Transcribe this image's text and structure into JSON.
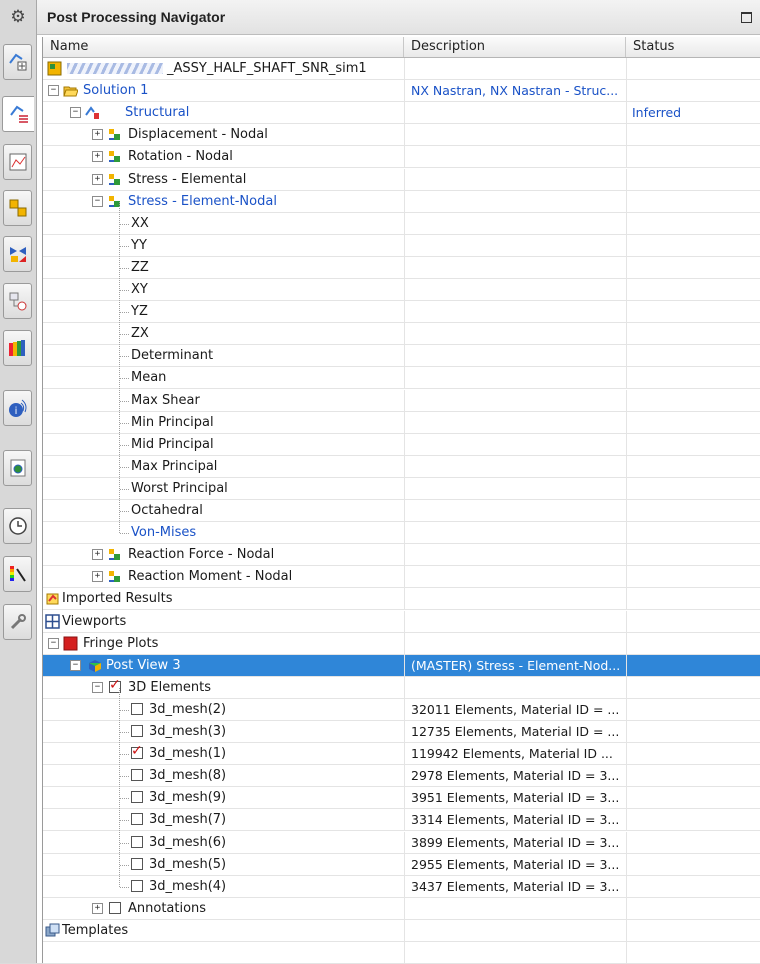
{
  "panel": {
    "title": "Post Processing Navigator"
  },
  "columns": {
    "name": "Name",
    "description": "Description",
    "status": "Status"
  },
  "rail": [
    {
      "icon": "gear-icon"
    },
    {
      "icon": "part-navigator-icon"
    },
    {
      "icon": "post-processing-navigator-icon"
    },
    {
      "icon": "graph-icon"
    },
    {
      "icon": "assembly-icon"
    },
    {
      "icon": "constraints-icon"
    },
    {
      "icon": "reuse-library-icon"
    },
    {
      "icon": "roles-icon"
    },
    {
      "icon": "info-icon"
    },
    {
      "icon": "web-browser-icon"
    },
    {
      "icon": "history-icon"
    },
    {
      "icon": "palette-icon"
    },
    {
      "icon": "tools-icon"
    }
  ],
  "tree": {
    "root": {
      "label": "_ASSY_HALF_SHAFT_SNR_sim1",
      "icon": "sim-file-icon"
    },
    "solution": {
      "label": "Solution 1",
      "description": "NX Nastran, NX Nastran - Struc...",
      "icon": "folder-open-icon"
    },
    "structural": {
      "label": "Structural",
      "status": "Inferred",
      "icon": "structural-icon"
    },
    "results": [
      {
        "label": "Displacement - Nodal",
        "expanded": false
      },
      {
        "label": "Rotation - Nodal",
        "expanded": false
      },
      {
        "label": "Stress - Elemental",
        "expanded": false
      },
      {
        "label": "Stress - Element-Nodal",
        "expanded": true
      }
    ],
    "stress_components": [
      "XX",
      "YY",
      "ZZ",
      "XY",
      "YZ",
      "ZX",
      "Determinant",
      "Mean",
      "Max Shear",
      "Min Principal",
      "Mid Principal",
      "Max Principal",
      "Worst Principal",
      "Octahedral",
      "Von-Mises"
    ],
    "active_component": "Von-Mises",
    "reactions": [
      {
        "label": "Reaction Force - Nodal"
      },
      {
        "label": "Reaction Moment - Nodal"
      }
    ],
    "imported_results": "Imported Results",
    "viewports": "Viewports",
    "fringe_plots": "Fringe Plots",
    "post_view": {
      "label": "Post View 3",
      "description": "(MASTER) Stress - Element-Nod..."
    },
    "elements_3d": "3D Elements",
    "meshes": [
      {
        "label": "3d_mesh(2)",
        "description": "32011 Elements, Material ID = ...",
        "checked": false
      },
      {
        "label": "3d_mesh(3)",
        "description": "12735 Elements, Material ID = ...",
        "checked": false
      },
      {
        "label": "3d_mesh(1)",
        "description": "119942 Elements, Material ID ...",
        "checked": true
      },
      {
        "label": "3d_mesh(8)",
        "description": "2978 Elements, Material ID = 3...",
        "checked": false
      },
      {
        "label": "3d_mesh(9)",
        "description": "3951 Elements, Material ID = 3...",
        "checked": false
      },
      {
        "label": "3d_mesh(7)",
        "description": "3314 Elements, Material ID = 3...",
        "checked": false
      },
      {
        "label": "3d_mesh(6)",
        "description": "3899 Elements, Material ID = 3...",
        "checked": false
      },
      {
        "label": "3d_mesh(5)",
        "description": "2955 Elements, Material ID = 3...",
        "checked": false
      },
      {
        "label": "3d_mesh(4)",
        "description": "3437 Elements, Material ID = 3...",
        "checked": false
      }
    ],
    "annotations": "Annotations",
    "templates": "Templates"
  },
  "colors": {
    "selection": "#2f86d8",
    "link_blue": "#1a52c7",
    "checkmark": "#cc1111",
    "fringe_red": "#d42020"
  }
}
